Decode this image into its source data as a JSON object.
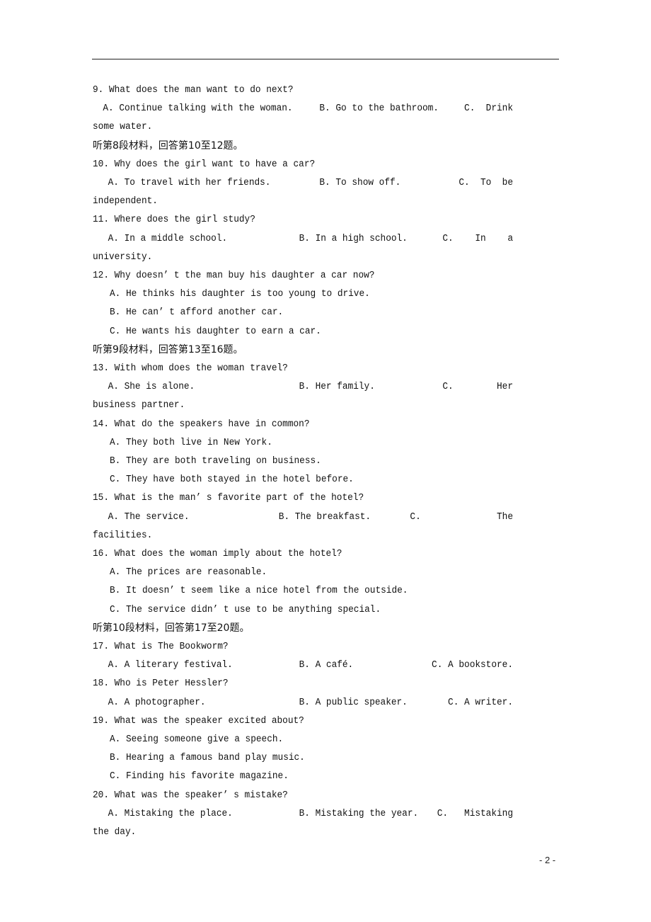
{
  "page_number": "- 2 -",
  "lines": [
    {
      "kind": "question",
      "text": "9. What does the man want to do next?"
    },
    {
      "kind": "options",
      "a": "A. Continue talking with the woman.",
      "b": "B. Go to the bathroom.",
      "c": "C.  Drink"
    },
    {
      "kind": "wrap",
      "text": "some water."
    },
    {
      "kind": "section",
      "text": "听第8段材料，回答第10至12题。"
    },
    {
      "kind": "question",
      "text": "10. Why does the girl want to have a car?"
    },
    {
      "kind": "options",
      "a": "A. To travel with her friends.",
      "b": "B. To show off.",
      "c": "C.  To  be"
    },
    {
      "kind": "wrap",
      "text": "independent."
    },
    {
      "kind": "question",
      "text": "11. Where does the girl study?"
    },
    {
      "kind": "options",
      "a": "A. In a middle school.",
      "b": "B. In a high school.",
      "c": "C.    In    a"
    },
    {
      "kind": "wrap",
      "text": "university."
    },
    {
      "kind": "question",
      "text": "12. Why doesn’ t the man buy his daughter a car now?"
    },
    {
      "kind": "option",
      "text": "A. He thinks his daughter is too young to drive."
    },
    {
      "kind": "option",
      "text": "B. He can’ t afford another car."
    },
    {
      "kind": "option",
      "text": "C. He wants his daughter to earn a car."
    },
    {
      "kind": "section",
      "text": "听第9段材料，回答第13至16题。"
    },
    {
      "kind": "question",
      "text": "13. With whom does the woman travel?"
    },
    {
      "kind": "options",
      "a": "A. She is alone.",
      "b": "B. Her family.",
      "c": "C.        Her"
    },
    {
      "kind": "wrap",
      "text": "business partner."
    },
    {
      "kind": "question",
      "text": "14. What do the speakers have in common?"
    },
    {
      "kind": "option",
      "text": "A. They both live in New York."
    },
    {
      "kind": "option",
      "text": "B. They are both traveling on business."
    },
    {
      "kind": "option",
      "text": "C. They have both stayed in the hotel before."
    },
    {
      "kind": "question",
      "text": "15. What is the man’ s favorite part of the hotel?"
    },
    {
      "kind": "options",
      "a": "A. The service.",
      "b": "B. The breakfast.",
      "c": "C.              The"
    },
    {
      "kind": "wrap",
      "text": "facilities."
    },
    {
      "kind": "question",
      "text": "16. What does the woman imply about the hotel?"
    },
    {
      "kind": "option",
      "text": "A. The prices are reasonable."
    },
    {
      "kind": "option",
      "text": "B. It doesn’ t seem like a nice hotel from the outside."
    },
    {
      "kind": "option",
      "text": "C. The service didn’ t use to be anything special."
    },
    {
      "kind": "section",
      "text": "听第10段材料，回答第17至20题。"
    },
    {
      "kind": "question",
      "text": "17. What is The Bookworm?"
    },
    {
      "kind": "options",
      "a": "A. A literary festival.",
      "b": "B. A café.",
      "c": "C. A bookstore."
    },
    {
      "kind": "question",
      "text": "18. Who is Peter Hessler?"
    },
    {
      "kind": "options",
      "a": "A. A photographer.",
      "b": "B. A public speaker.",
      "c": "C. A writer."
    },
    {
      "kind": "question",
      "text": "19. What was the speaker excited about?"
    },
    {
      "kind": "option",
      "text": "A. Seeing someone give a speech."
    },
    {
      "kind": "option",
      "text": "B. Hearing a famous band play music."
    },
    {
      "kind": "option",
      "text": "C. Finding his favorite magazine."
    },
    {
      "kind": "question",
      "text": "20. What was the speaker’ s mistake?"
    },
    {
      "kind": "options",
      "a": "A. Mistaking the place.",
      "b": "B. Mistaking the year.",
      "c": "C.   Mistaking"
    },
    {
      "kind": "wrap",
      "text": "the day."
    }
  ]
}
